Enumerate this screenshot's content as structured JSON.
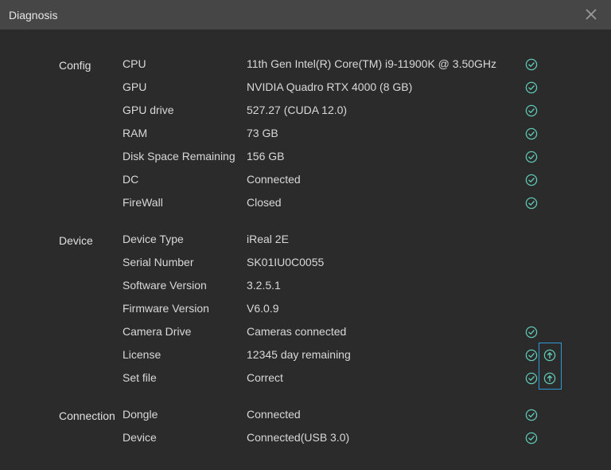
{
  "window": {
    "title": "Diagnosis"
  },
  "colors": {
    "accent": "#5fc7b3",
    "highlight": "#2e9bd6"
  },
  "icons": {
    "close": "close-icon",
    "ok": "check-circle-icon",
    "upload": "upload-circle-icon"
  },
  "sections": {
    "config": {
      "label": "Config",
      "rows": [
        {
          "label": "CPU",
          "value": "11th Gen Intel(R) Core(TM) i9-11900K @ 3.50GHz"
        },
        {
          "label": "GPU",
          "value": "NVIDIA Quadro RTX 4000 (8 GB)"
        },
        {
          "label": "GPU drive",
          "value": "527.27 (CUDA 12.0)"
        },
        {
          "label": "RAM",
          "value": "73 GB"
        },
        {
          "label": "Disk Space Remaining",
          "value": "156 GB"
        },
        {
          "label": "DC",
          "value": "Connected"
        },
        {
          "label": "FireWall",
          "value": "Closed"
        }
      ]
    },
    "device": {
      "label": "Device",
      "rows": [
        {
          "label": "Device Type",
          "value": "iReal 2E"
        },
        {
          "label": "Serial Number",
          "value": "SK01IU0C0055"
        },
        {
          "label": "Software Version",
          "value": "3.2.5.1"
        },
        {
          "label": "Firmware Version",
          "value": "V6.0.9"
        },
        {
          "label": "Camera Drive",
          "value": "Cameras connected"
        },
        {
          "label": "License",
          "value": "12345 day remaining"
        },
        {
          "label": "Set file",
          "value": "Correct"
        }
      ]
    },
    "connection": {
      "label": "Connection",
      "rows": [
        {
          "label": "Dongle",
          "value": "Connected"
        },
        {
          "label": "Device",
          "value": "Connected(USB 3.0)"
        }
      ]
    }
  }
}
